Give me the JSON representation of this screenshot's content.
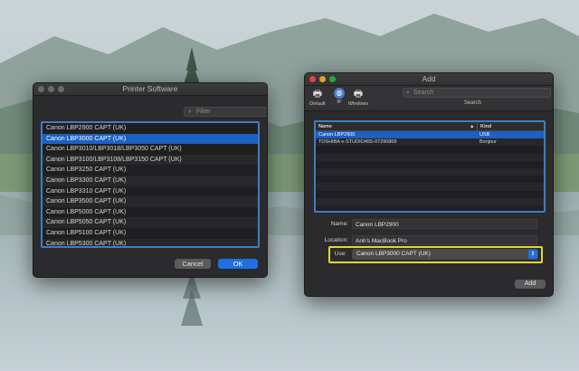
{
  "printer_software": {
    "title": "Printer Software",
    "filter_placeholder": "Filter",
    "items": [
      "Canon LBP2900 CAPT (UK)",
      "Canon LBP3000 CAPT (UK)",
      "Canon LBP3010/LBP3018/LBP3050 CAPT (UK)",
      "Canon LBP3100/LBP3108/LBP3150 CAPT (UK)",
      "Canon LBP3250 CAPT (UK)",
      "Canon LBP3300 CAPT (UK)",
      "Canon LBP3310 CAPT (UK)",
      "Canon LBP3500 CAPT (UK)",
      "Canon LBP5000 CAPT (UK)",
      "Canon LBP5050 CAPT (UK)",
      "Canon LBP5100 CAPT (UK)",
      "Canon LBP5300 CAPT (UK)"
    ],
    "selected_item": "Canon LBP3000 CAPT (UK)",
    "cancel_label": "Cancel",
    "ok_label": "OK"
  },
  "add_window": {
    "title": "Add",
    "toolbar": {
      "default_label": "Default",
      "ip_label": "IP",
      "windows_label": "Windows",
      "search_placeholder": "Search",
      "search_label": "Search"
    },
    "table": {
      "col_name": "Name",
      "col_kind": "Kind",
      "sort_indicator": "▲",
      "rows": [
        {
          "name": "Canon LBP2900",
          "kind": "USB"
        },
        {
          "name": "TOSHIBA e-STUDIO455-07290869",
          "kind": "Bonjour"
        }
      ],
      "selected_row": "Canon LBP2900"
    },
    "name_label": "Name:",
    "name_value": "Canon LBP2900",
    "location_label": "Location:",
    "location_value": "Anh's MacBook Pro",
    "use_label": "Use:",
    "use_value": "Canon LBP3000 CAPT (UK)",
    "add_button_label": "Add"
  },
  "colors": {
    "selection": "#1e5fc2",
    "list_border": "#3b7fc4",
    "highlight_frame": "#e2d634",
    "ok_button": "#1f6fe0"
  },
  "icons": {
    "default_printer": "printer-icon",
    "ip": "globe-icon",
    "windows": "windows-printer-icon",
    "search": "search-icon"
  }
}
